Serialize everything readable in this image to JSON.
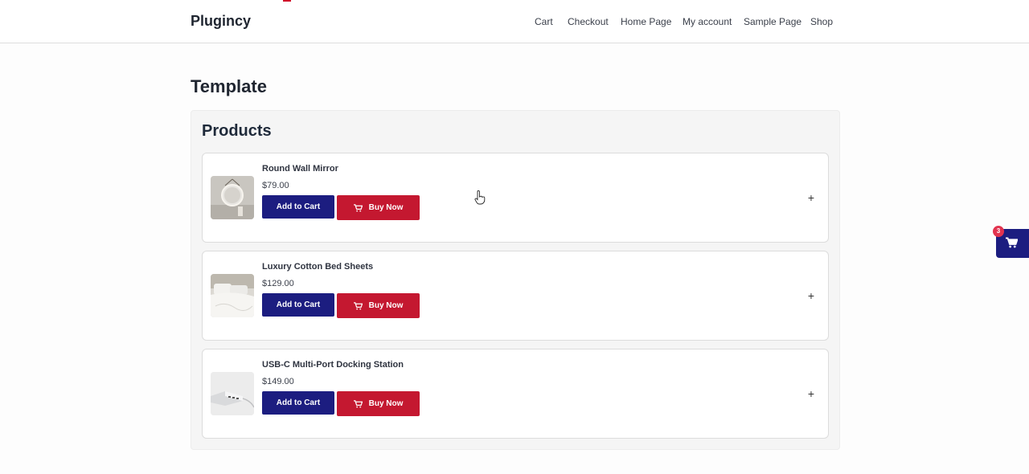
{
  "header": {
    "brand": "Plugincy",
    "nav": [
      "Cart",
      "Checkout",
      "Home Page",
      "My account",
      "Sample Page",
      "Shop"
    ]
  },
  "page": {
    "title": "Template"
  },
  "products_section": {
    "title": "Products",
    "items": [
      {
        "name": "Round Wall Mirror",
        "price": "$79.00",
        "add_to_cart": "Add to Cart",
        "buy_now": "Buy Now",
        "expand_icon": "+"
      },
      {
        "name": "Luxury Cotton Bed Sheets",
        "price": "$129.00",
        "add_to_cart": "Add to Cart",
        "buy_now": "Buy Now",
        "expand_icon": "+"
      },
      {
        "name": "USB-C Multi-Port Docking Station",
        "price": "$149.00",
        "add_to_cart": "Add to Cart",
        "buy_now": "Buy Now",
        "expand_icon": "+"
      }
    ]
  },
  "floating_cart": {
    "count": "3",
    "icon": "cart-icon"
  },
  "colors": {
    "primary": "#1c1d80",
    "buy": "#c41830",
    "badge": "#e2334f"
  }
}
